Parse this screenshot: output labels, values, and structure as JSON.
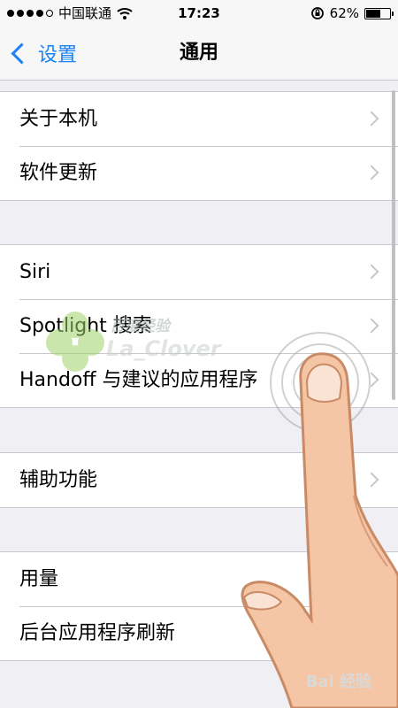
{
  "status_bar": {
    "carrier": "中国联通",
    "time": "17:23",
    "battery_percent": "62%",
    "battery_level": 0.62,
    "signal_bars_filled": 4,
    "signal_bars_total": 5
  },
  "nav": {
    "back_label": "设置",
    "title": "通用"
  },
  "groups": [
    {
      "items": [
        "关于本机",
        "软件更新"
      ]
    },
    {
      "items": [
        "Siri",
        "Spotlight 搜索",
        "Handoff 与建议的应用程序"
      ]
    },
    {
      "items": [
        "辅助功能"
      ]
    },
    {
      "items": [
        "用量",
        "后台应用程序刷新"
      ]
    }
  ],
  "watermark": {
    "line1": "百度经验",
    "line2": "La_Clover",
    "site": "Bai 经验"
  },
  "colors": {
    "accent": "#1a82f6",
    "background": "#efeff4",
    "separator": "#c8c7cc"
  }
}
